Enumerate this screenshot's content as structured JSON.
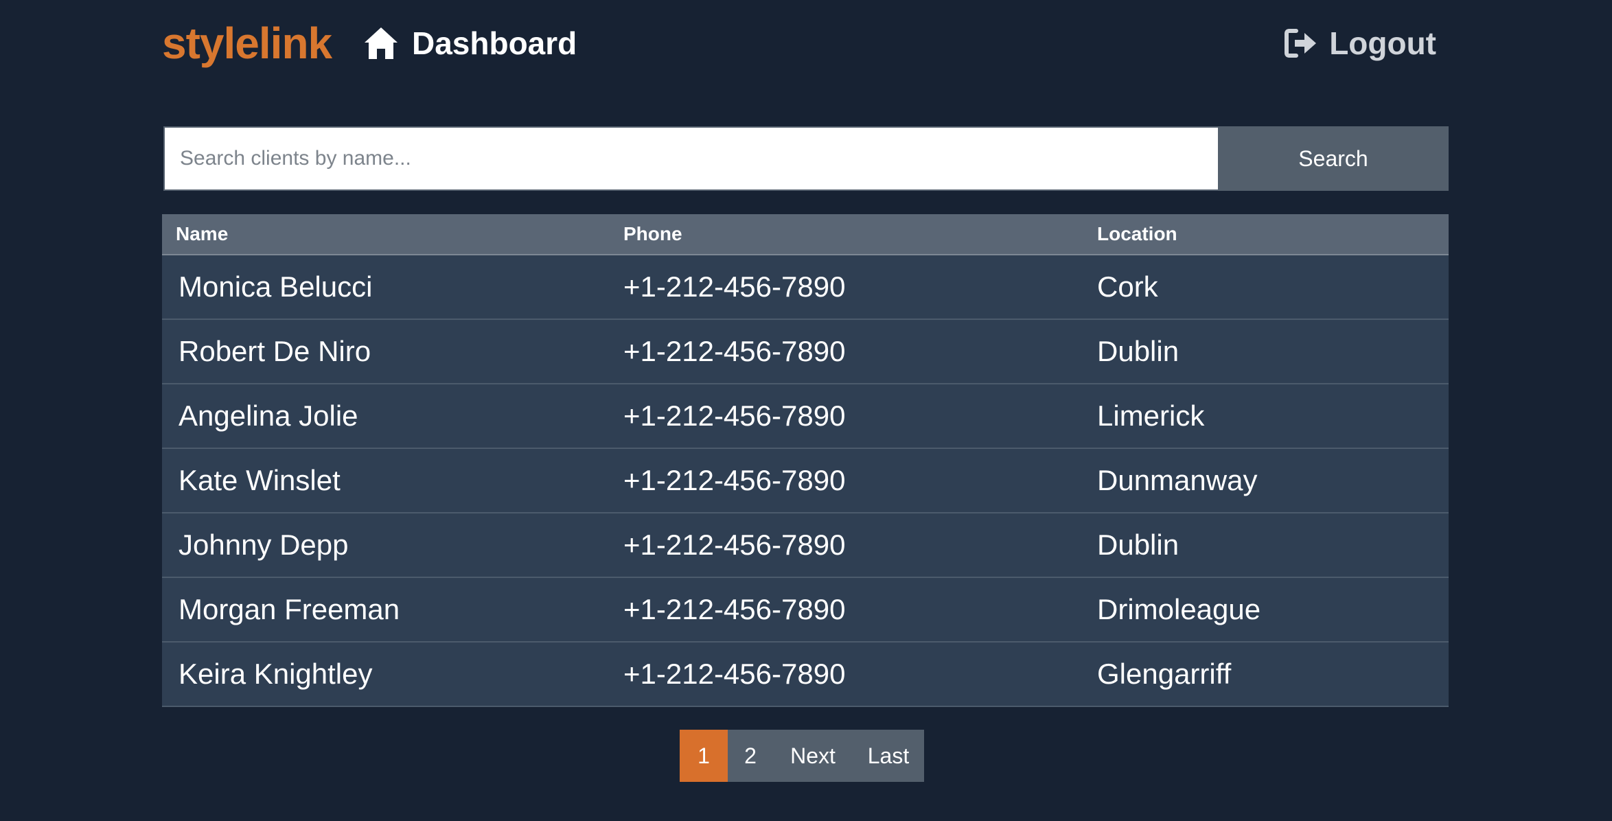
{
  "header": {
    "brand": "stylelink",
    "home_label": "Dashboard",
    "home_icon": "home-icon",
    "logout_label": "Logout",
    "logout_icon": "sign-out-icon"
  },
  "search": {
    "placeholder": "Search clients by name...",
    "value": "",
    "button_label": "Search"
  },
  "table": {
    "columns": [
      "Name",
      "Phone",
      "Location"
    ],
    "rows": [
      {
        "name": "Monica Belucci",
        "phone": "+1-212-456-7890",
        "location": "Cork"
      },
      {
        "name": "Robert De Niro",
        "phone": "+1-212-456-7890",
        "location": "Dublin"
      },
      {
        "name": "Angelina Jolie",
        "phone": "+1-212-456-7890",
        "location": "Limerick"
      },
      {
        "name": "Kate Winslet",
        "phone": "+1-212-456-7890",
        "location": "Dunmanway"
      },
      {
        "name": "Johnny Depp",
        "phone": "+1-212-456-7890",
        "location": "Dublin"
      },
      {
        "name": "Morgan Freeman",
        "phone": "+1-212-456-7890",
        "location": "Drimoleague"
      },
      {
        "name": "Keira Knightley",
        "phone": "+1-212-456-7890",
        "location": "Glengarriff"
      }
    ]
  },
  "pagination": {
    "pages": [
      "1",
      "2"
    ],
    "current_page": "1",
    "next_label": "Next",
    "last_label": "Last"
  },
  "colors": {
    "background": "#172233",
    "brand": "#d8772f",
    "active_page": "#d8702c",
    "button": "#535f6c",
    "table_header": "#5a6675",
    "table_row": "#2f3f53"
  }
}
